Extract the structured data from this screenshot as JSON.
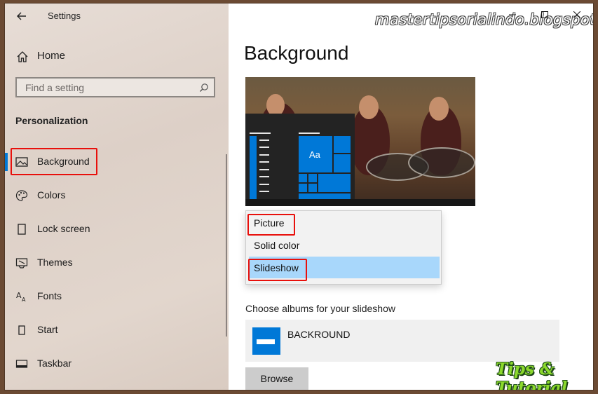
{
  "window": {
    "title": "Settings",
    "watermark": "mastertipsorialindo.blogspot.com",
    "controls": [
      "minimize-icon",
      "maximize-icon",
      "close-icon"
    ]
  },
  "sidebar": {
    "home_label": "Home",
    "search_placeholder": "Find a setting",
    "section_heading": "Personalization",
    "items": [
      {
        "label": "Background",
        "icon": "picture-icon",
        "active": true
      },
      {
        "label": "Colors",
        "icon": "palette-icon"
      },
      {
        "label": "Lock screen",
        "icon": "lock-screen-icon"
      },
      {
        "label": "Themes",
        "icon": "brush-icon"
      },
      {
        "label": "Fonts",
        "icon": "font-icon"
      },
      {
        "label": "Start",
        "icon": "start-icon"
      },
      {
        "label": "Taskbar",
        "icon": "taskbar-icon"
      }
    ]
  },
  "main": {
    "page_title": "Background",
    "preview_tile_text": "Aa",
    "dropdown": {
      "options": [
        "Picture",
        "Solid color",
        "Slideshow"
      ],
      "selected": "Slideshow"
    },
    "albums_label": "Choose albums for your slideshow",
    "album_name": "BACKROUND",
    "browse_label": "Browse"
  },
  "branding": {
    "logo_text": "Tips & Tutorial"
  },
  "colors": {
    "accent": "#0078d7",
    "highlight_red": "#e8100c",
    "dropdown_selected": "#a8d7fb"
  }
}
